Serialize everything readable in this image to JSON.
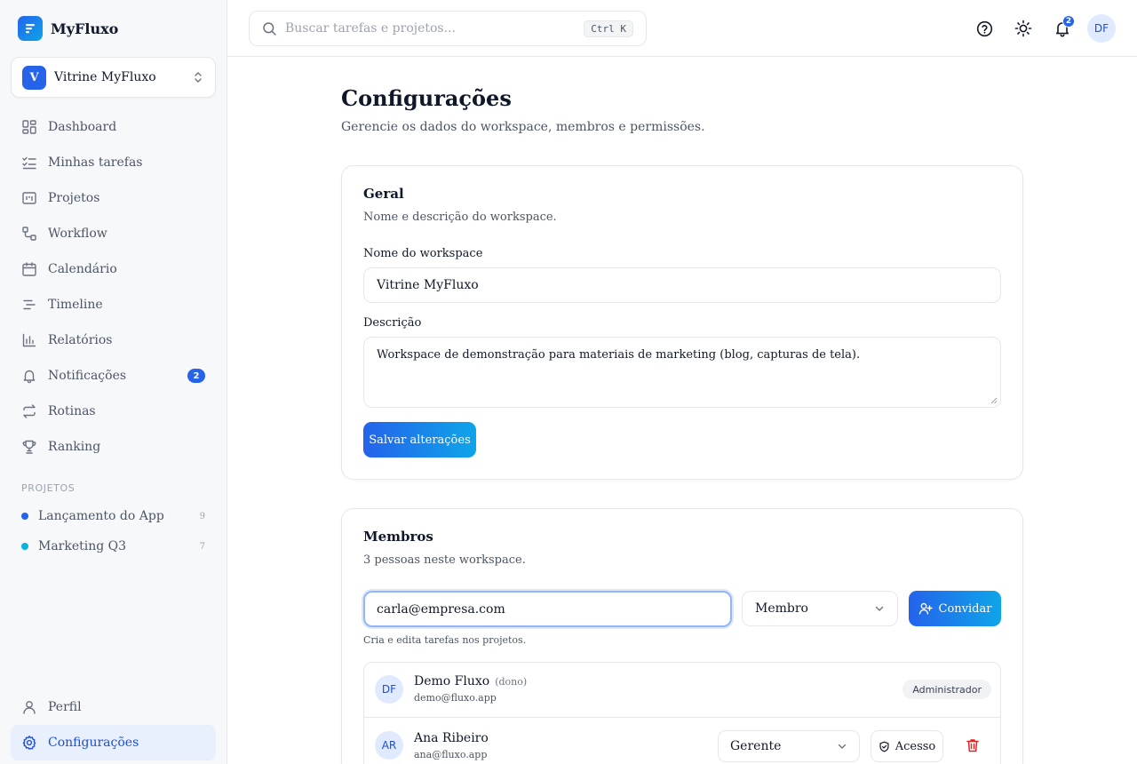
{
  "brand": {
    "name": "MyFluxo"
  },
  "workspace": {
    "initial": "V",
    "name": "Vitrine MyFluxo"
  },
  "nav": {
    "items": [
      {
        "label": "Dashboard",
        "icon": "dashboard-icon"
      },
      {
        "label": "Minhas tarefas",
        "icon": "task-list-icon"
      },
      {
        "label": "Projetos",
        "icon": "projects-icon"
      },
      {
        "label": "Workflow",
        "icon": "workflow-icon"
      },
      {
        "label": "Calendário",
        "icon": "calendar-icon"
      },
      {
        "label": "Timeline",
        "icon": "timeline-icon"
      },
      {
        "label": "Relatórios",
        "icon": "reports-icon"
      },
      {
        "label": "Notificações",
        "icon": "bell-icon",
        "badge": "2"
      },
      {
        "label": "Rotinas",
        "icon": "repeat-icon"
      },
      {
        "label": "Ranking",
        "icon": "trophy-icon"
      }
    ],
    "projects_label": "PROJETOS",
    "projects": [
      {
        "name": "Lançamento do App",
        "count": "9",
        "color": "#2563eb"
      },
      {
        "name": "Marketing Q3",
        "count": "7",
        "color": "#06b6d4"
      }
    ],
    "bottom": [
      {
        "label": "Perfil",
        "icon": "user-icon"
      },
      {
        "label": "Configurações",
        "icon": "gear-icon"
      }
    ]
  },
  "topbar": {
    "search_placeholder": "Buscar tarefas e projetos...",
    "shortcut": "Ctrl K",
    "notifications_count": "2",
    "user_initials": "DF"
  },
  "page": {
    "title": "Configurações",
    "subtitle": "Gerencie os dados do workspace, membros e permissões."
  },
  "general": {
    "title": "Geral",
    "subtitle": "Nome e descrição do workspace.",
    "name_label": "Nome do workspace",
    "name_value": "Vitrine MyFluxo",
    "description_label": "Descrição",
    "description_value": "Workspace de demonstração para materiais de marketing (blog, capturas de tela).",
    "save_label": "Salvar alterações"
  },
  "members": {
    "title": "Membros",
    "subtitle": "3 pessoas neste workspace.",
    "invite_email": "carla@empresa.com",
    "invite_role": "Membro",
    "invite_label": "Convidar",
    "role_hint": "Cria e edita tarefas nos projetos.",
    "list": [
      {
        "initials": "DF",
        "name": "Demo Fluxo",
        "tag": "(dono)",
        "email": "demo@fluxo.app",
        "role": "Administrador"
      },
      {
        "initials": "AR",
        "name": "Ana Ribeiro",
        "email": "ana@fluxo.app",
        "role": "Gerente",
        "access_label": "Acesso"
      }
    ]
  },
  "colors": {
    "accent": "#2563eb",
    "accent_gradient_end": "#0ea5e9",
    "danger": "#dc2626"
  }
}
